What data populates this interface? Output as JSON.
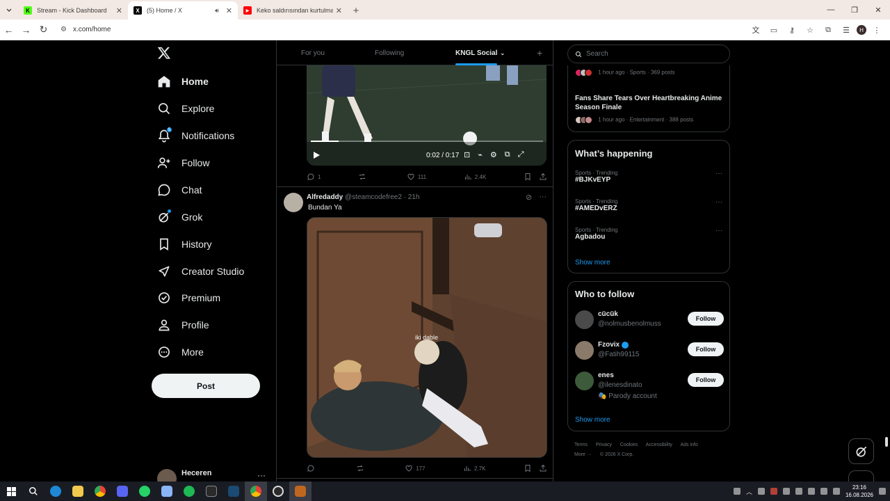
{
  "browser": {
    "tabs": [
      {
        "title": "Stream - Kick Dashboard",
        "favicon_color": "#53fc18",
        "favicon_letter": "K",
        "active": false
      },
      {
        "title": "(5) Home / X",
        "favicon_color": "#000000",
        "favicon_letter": "X",
        "active": true
      },
      {
        "title": "Keko saldırısından kurtulmak için",
        "favicon_color": "#ff0000",
        "favicon_letter": "▶",
        "active": false
      }
    ],
    "url": "x.com/home",
    "profile_initial": "H"
  },
  "nav": {
    "items": [
      {
        "label": "Home",
        "icon": "home-icon"
      },
      {
        "label": "Explore",
        "icon": "search-icon"
      },
      {
        "label": "Notifications",
        "icon": "bell-icon",
        "badge": "5"
      },
      {
        "label": "Follow",
        "icon": "person-plus-icon"
      },
      {
        "label": "Chat",
        "icon": "chat-icon"
      },
      {
        "label": "Grok",
        "icon": "grok-icon"
      },
      {
        "label": "History",
        "icon": "bookmark-icon"
      },
      {
        "label": "Creator Studio",
        "icon": "rocket-icon"
      },
      {
        "label": "Premium",
        "icon": "premium-icon"
      },
      {
        "label": "Profile",
        "icon": "person-icon"
      },
      {
        "label": "More",
        "icon": "more-circle-icon"
      }
    ],
    "post_label": "Post",
    "account_name": "Heceren"
  },
  "feed": {
    "tabs": [
      "For you",
      "Following",
      "KNGL Social"
    ],
    "post1": {
      "video_time": "0:02 / 0:17",
      "video_progress": 0.12,
      "replies": "1",
      "reposts": "",
      "likes": "111",
      "views": "2.4K"
    },
    "post2": {
      "name": "Alfredaddy",
      "handle": "@steamcodefree2",
      "time": "21h",
      "text": "Bundan Ya",
      "caption": "iki dable",
      "replies": "",
      "reposts": "",
      "likes": "177",
      "views": "2.7K"
    }
  },
  "sidebar": {
    "search_placeholder": "Search",
    "trends_top": [
      {
        "meta": "1 hour ago · Sports · 369 posts"
      },
      {
        "title": "Fans Share Tears Over Heartbreaking Anime Season Finale",
        "meta": "1 hour ago · Entertainment · 388 posts"
      }
    ],
    "happening": {
      "title": "What’s happening",
      "items": [
        {
          "meta": "Sports · Trending",
          "tag": "#BJKvEYP"
        },
        {
          "meta": "Sports · Trending",
          "tag": "#AMEDvERZ"
        },
        {
          "meta": "Sports · Trending",
          "tag": "Agbadou"
        }
      ],
      "show_more": "Show more"
    },
    "who_to_follow": {
      "title": "Who to follow",
      "users": [
        {
          "name": "cücük",
          "handle": "@nolmusbenolmuss",
          "verified": false,
          "note": "",
          "avatar_color": "#4a4a4a"
        },
        {
          "name": "Fzovix",
          "handle": "@Fatih99115",
          "verified": true,
          "note": "",
          "avatar_color": "#8a7a6a"
        },
        {
          "name": "enes",
          "handle": "@ilenesdinato",
          "verified": false,
          "note": "🎭 Parody account",
          "avatar_color": "#3d5a3a"
        }
      ],
      "follow_label": "Follow",
      "show_more": "Show more"
    },
    "footer": [
      "Terms",
      "Privacy",
      "Cookies",
      "Accessibility",
      "Ads info",
      "More ···",
      "© 2026 X Corp."
    ]
  },
  "taskbar": {
    "time": "23:16",
    "date": "16.08.2026"
  }
}
